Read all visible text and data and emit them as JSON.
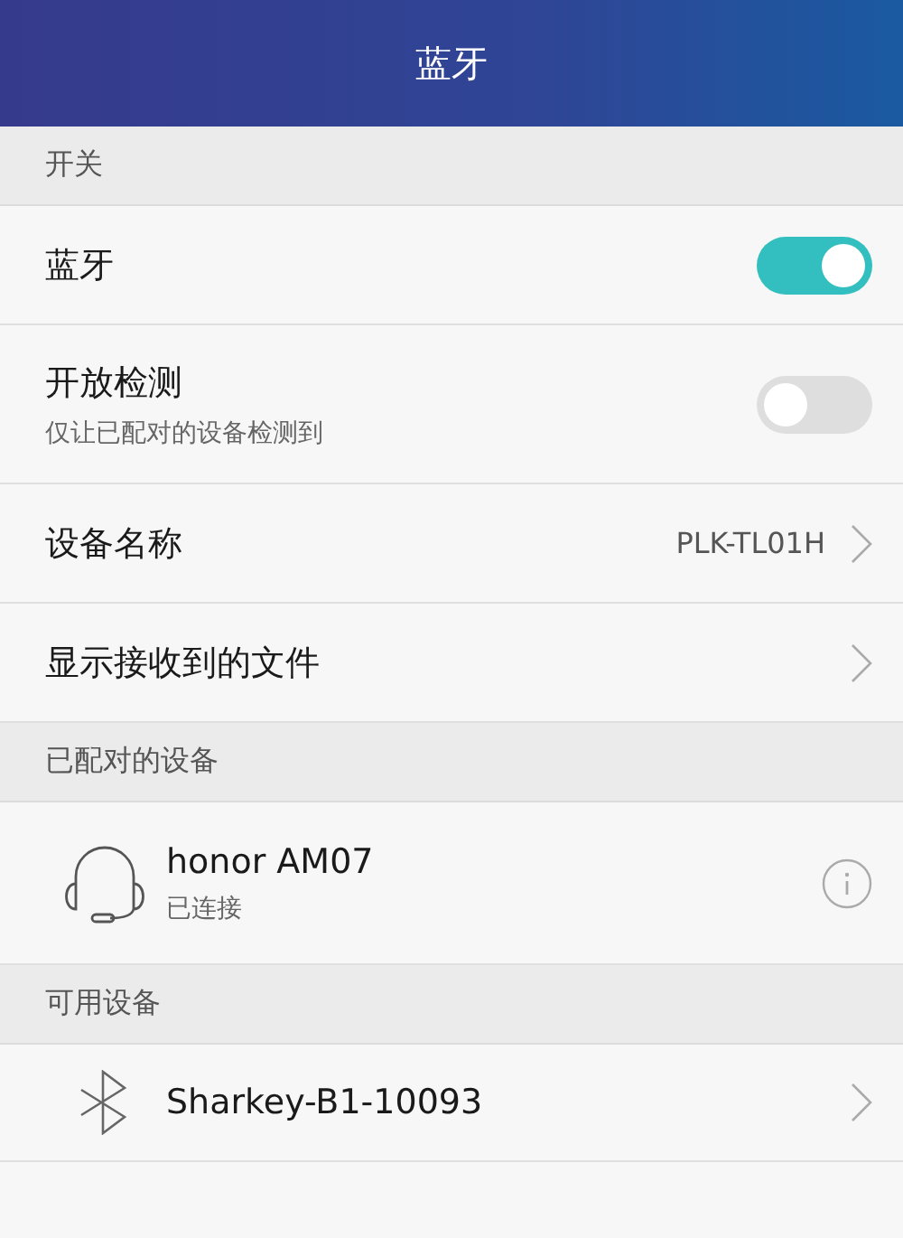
{
  "header": {
    "title": "蓝牙"
  },
  "sections": [
    {
      "label": "开关",
      "items": [
        {
          "kind": "toggle",
          "title": "蓝牙",
          "on": true
        },
        {
          "kind": "toggle",
          "title": "开放检测",
          "subtitle": "仅让已配对的设备检测到",
          "on": false
        },
        {
          "kind": "link",
          "title": "设备名称",
          "value": "PLK-TL01H"
        },
        {
          "kind": "link",
          "title": "显示接收到的文件"
        }
      ]
    },
    {
      "label": "已配对的设备",
      "items": [
        {
          "kind": "paired",
          "title": "honor AM07",
          "subtitle": "已连接"
        }
      ]
    },
    {
      "label": "可用设备",
      "items": [
        {
          "kind": "available",
          "title": "Sharkey-B1-10093"
        }
      ]
    }
  ]
}
